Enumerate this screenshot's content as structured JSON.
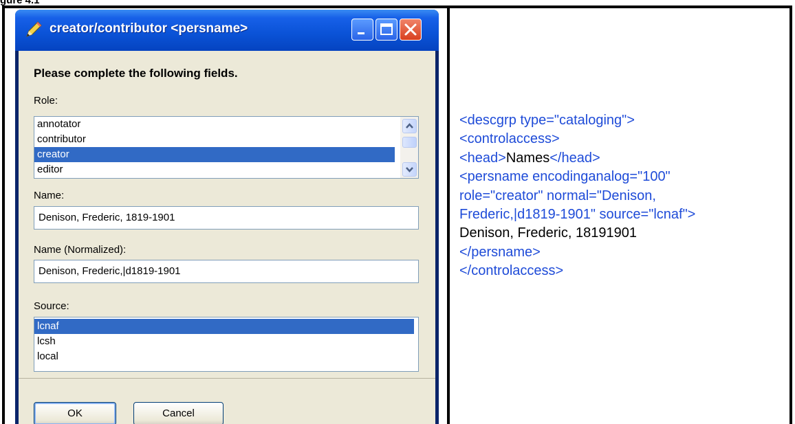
{
  "figure_label": "gure 4.1",
  "dialog": {
    "title": "creator/contributor <persname>",
    "instruction": "Please complete the following fields.",
    "role": {
      "label": "Role:",
      "options": [
        "annotator",
        "contributor",
        "creator",
        "editor"
      ],
      "selected": "creator"
    },
    "name": {
      "label": "Name:",
      "value": "Denison, Frederic, 1819-1901"
    },
    "name_normalized": {
      "label": "Name (Normalized):",
      "value": "Denison, Frederic,|d1819-1901"
    },
    "source": {
      "label": "Source:",
      "options": [
        "lcnaf",
        "lcsh",
        "local"
      ],
      "selected": "lcnaf"
    },
    "ok_label": "OK",
    "cancel_label": "Cancel"
  },
  "code": {
    "line1": "<descgrp type=\"cataloging\">",
    "line2": "<controlaccess>",
    "line3_open": "<head>",
    "line3_text": "Names",
    "line3_close": "</head>",
    "line4": "<persname encodinganalog=\"100\"",
    "line5": "role=\"creator\" normal=\"Denison,",
    "line6": "Frederic,|d1819-1901\" source=\"lcnaf\">",
    "line7": "Denison, Frederic, 18191901",
    "line8": "</persname>",
    "line9": "</controlaccess>"
  },
  "colors": {
    "markup": "#1e4bd8",
    "text": "#000000",
    "selection": "#316ac5",
    "titlebar": "#0a52d6"
  }
}
